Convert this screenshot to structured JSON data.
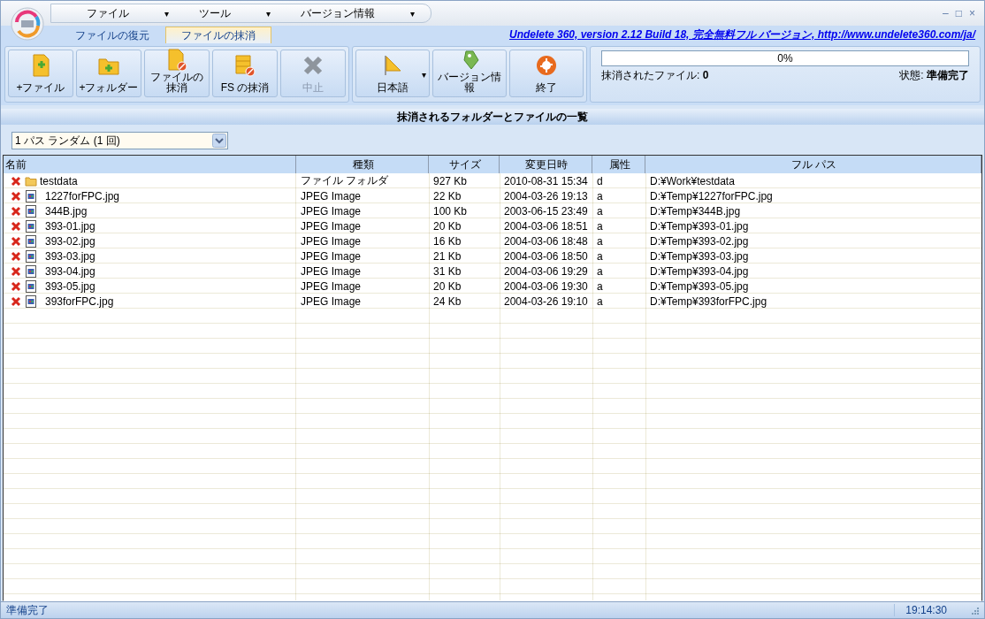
{
  "menu": [
    {
      "label": "ファイル",
      "caret": "▾"
    },
    {
      "label": "ツール",
      "caret": "▾"
    },
    {
      "label": "バージョン情報",
      "caret": "▾"
    }
  ],
  "window_controls": [
    "–",
    "□",
    "×"
  ],
  "tabs": [
    {
      "label": "ファイルの復元",
      "selected": false
    },
    {
      "label": "ファイルの抹消",
      "selected": true
    }
  ],
  "link": "Undelete 360, version 2.12 Build 18, 完全無料フル バージョン, http://www.undelete360.com/ja/",
  "toolbar": [
    [
      {
        "kind": "add-file",
        "label": "+ファイル",
        "disabled": false
      },
      {
        "kind": "add-folder",
        "label": "+フォルダー",
        "disabled": false
      },
      {
        "kind": "wipe-file",
        "label": "ファイルの抹消",
        "disabled": false
      },
      {
        "kind": "wipe-fs",
        "label": "FS の抹消",
        "disabled": false
      },
      {
        "kind": "stop",
        "label": "中止",
        "disabled": true
      }
    ],
    [
      {
        "kind": "language",
        "label": "日本語",
        "caret": "▾",
        "disabled": false
      },
      {
        "kind": "about",
        "label": "バージョン情報",
        "disabled": false
      },
      {
        "kind": "exit",
        "label": "終了",
        "disabled": false
      }
    ]
  ],
  "progress": {
    "level": 0,
    "reading": "0%"
  },
  "wiped_files": {
    "label": "抹消されたファイル:",
    "value": "0"
  },
  "state": {
    "label": "状態:",
    "value": "準備完了"
  },
  "section_title": "抹消されるフォルダーとファイルの一覧",
  "method": {
    "value": "1 パス ランダム (1 回)"
  },
  "table": {
    "columns": [
      "名前",
      "種類",
      "サイズ",
      "変更日時",
      "属性",
      "フル パス"
    ],
    "rows": [
      {
        "kind": "folder",
        "cells": [
          "testdata",
          "ファイル フォルダ",
          "927 Kb",
          "2010-08-31 15:34",
          "d",
          "D:¥Work¥testdata"
        ]
      },
      {
        "kind": "image",
        "cells": [
          "1227forFPC.jpg",
          "JPEG Image",
          "22 Kb",
          "2004-03-26 19:13",
          "a",
          "D:¥Temp¥1227forFPC.jpg"
        ]
      },
      {
        "kind": "image",
        "cells": [
          "344B.jpg",
          "JPEG Image",
          "100 Kb",
          "2003-06-15 23:49",
          "a",
          "D:¥Temp¥344B.jpg"
        ]
      },
      {
        "kind": "image",
        "cells": [
          "393-01.jpg",
          "JPEG Image",
          "20 Kb",
          "2004-03-06 18:51",
          "a",
          "D:¥Temp¥393-01.jpg"
        ]
      },
      {
        "kind": "image",
        "cells": [
          "393-02.jpg",
          "JPEG Image",
          "16 Kb",
          "2004-03-06 18:48",
          "a",
          "D:¥Temp¥393-02.jpg"
        ]
      },
      {
        "kind": "image",
        "cells": [
          "393-03.jpg",
          "JPEG Image",
          "21 Kb",
          "2004-03-06 18:50",
          "a",
          "D:¥Temp¥393-03.jpg"
        ]
      },
      {
        "kind": "image",
        "cells": [
          "393-04.jpg",
          "JPEG Image",
          "31 Kb",
          "2004-03-06 19:29",
          "a",
          "D:¥Temp¥393-04.jpg"
        ]
      },
      {
        "kind": "image",
        "cells": [
          "393-05.jpg",
          "JPEG Image",
          "20 Kb",
          "2004-03-06 19:30",
          "a",
          "D:¥Temp¥393-05.jpg"
        ]
      },
      {
        "kind": "image",
        "cells": [
          "393forFPC.jpg",
          "JPEG Image",
          "24 Kb",
          "2004-03-26 19:10",
          "a",
          "D:¥Temp¥393forFPC.jpg"
        ]
      }
    ]
  },
  "status_bar": {
    "message": "準備完了",
    "time": "19:14:30"
  }
}
